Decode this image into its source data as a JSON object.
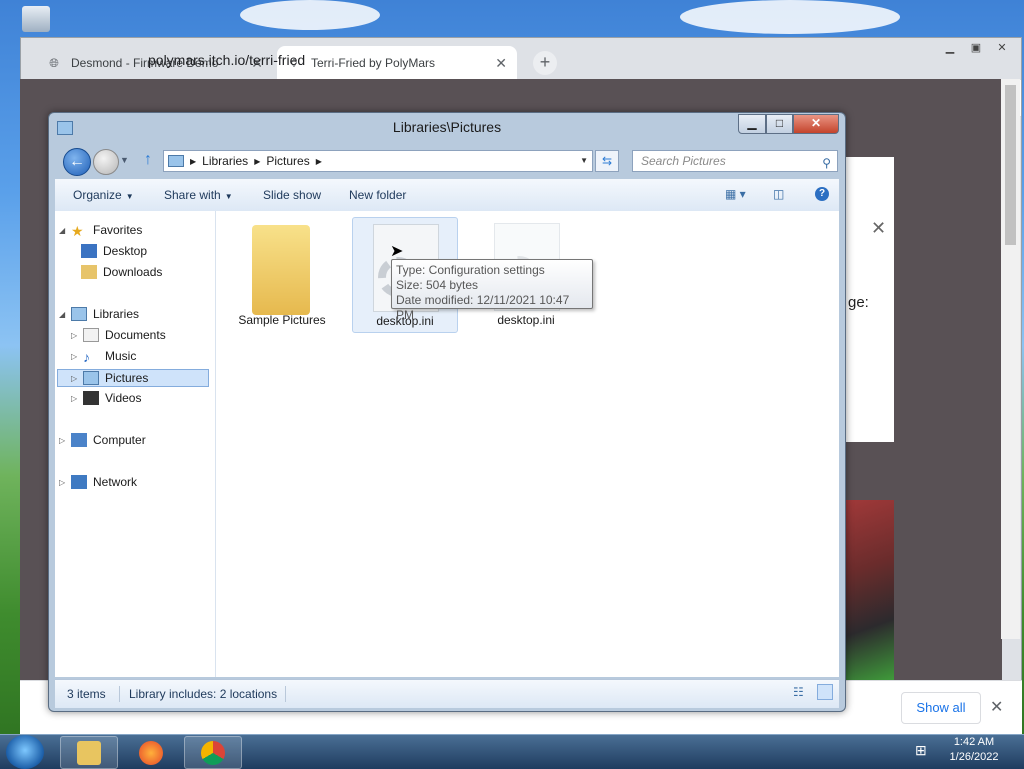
{
  "browser": {
    "tabs": [
      {
        "title": "Desmond - Firmware Demo",
        "active": false
      },
      {
        "title": "Terri-Fried by PolyMars",
        "active": true
      }
    ],
    "address": "polymars.itch.io/terri-fried",
    "page_partial_text": "ge:",
    "download_bar": {
      "show_all_label": "Show all"
    }
  },
  "explorer": {
    "title": "Libraries\\Pictures",
    "breadcrumb": [
      "Libraries",
      "Pictures"
    ],
    "search_placeholder": "Search Pictures",
    "commands": {
      "organize": "Organize",
      "share_with": "Share with",
      "slide_show": "Slide show",
      "new_folder": "New folder"
    },
    "nav": {
      "favorites": "Favorites",
      "desktop": "Desktop",
      "downloads": "Downloads",
      "libraries": "Libraries",
      "documents": "Documents",
      "music": "Music",
      "pictures": "Pictures",
      "videos": "Videos",
      "computer": "Computer",
      "network": "Network"
    },
    "files": [
      {
        "name": "Sample Pictures",
        "icon": "folder-icon"
      },
      {
        "name": "desktop.ini",
        "icon": "config-file-icon",
        "selected": true
      },
      {
        "name": "desktop.ini",
        "icon": "config-file-icon"
      }
    ],
    "tooltip": {
      "type": "Type: Configuration settings",
      "size": "Size: 504 bytes",
      "modified": "Date modified: 12/11/2021 10:47 PM"
    },
    "status": {
      "count": "3 items",
      "library": "Library includes: 2 locations"
    }
  },
  "taskbar": {
    "time": "1:42 AM",
    "date": "1/26/2022"
  }
}
